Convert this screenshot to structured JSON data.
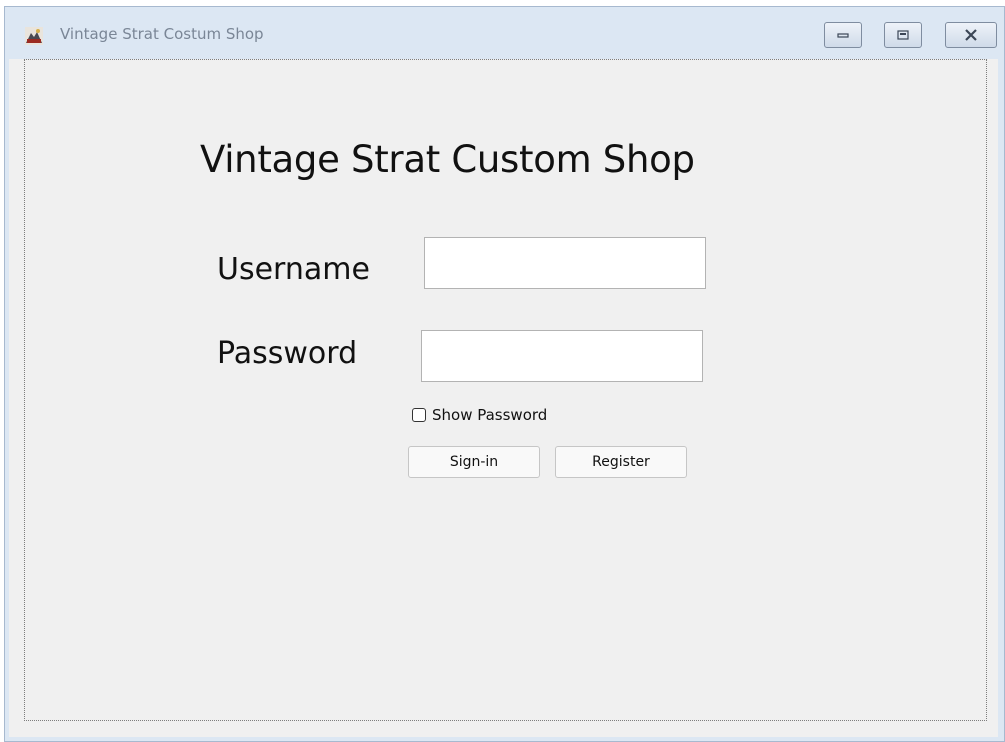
{
  "window": {
    "title": "Vintage Strat Costum Shop"
  },
  "form": {
    "heading": "Vintage Strat Custom Shop",
    "username_label": "Username",
    "username_value": "",
    "password_label": "Password",
    "password_value": "",
    "show_password_label": "Show Password",
    "show_password_checked": false,
    "signin_label": "Sign-in",
    "register_label": "Register"
  },
  "icons": {
    "app": "app-icon",
    "minimize": "minimize-icon",
    "maximize": "maximize-icon",
    "close": "close-icon"
  }
}
